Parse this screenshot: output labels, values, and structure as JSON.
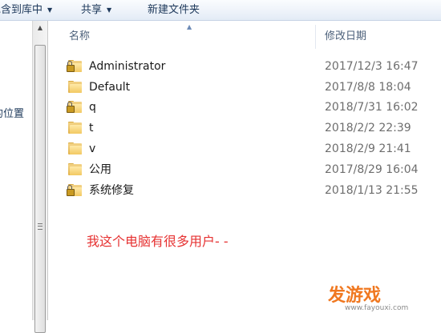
{
  "toolbar": {
    "include_in_library_label": "包含到库中",
    "share_label": "共享",
    "new_folder_label": "新建文件夹"
  },
  "nav": {
    "location_label": "的位置"
  },
  "columns": {
    "name": "名称",
    "modified": "修改日期"
  },
  "files": [
    {
      "name": "Administrator",
      "date": "2017/12/3 16:47",
      "locked": true
    },
    {
      "name": "Default",
      "date": "2017/8/8 18:04",
      "locked": false
    },
    {
      "name": "q",
      "date": "2018/7/31 16:02",
      "locked": true
    },
    {
      "name": "t",
      "date": "2018/2/2 22:39",
      "locked": false
    },
    {
      "name": "v",
      "date": "2018/2/9 21:41",
      "locked": false
    },
    {
      "name": "公用",
      "date": "2017/8/29 16:04",
      "locked": false
    },
    {
      "name": "系统修复",
      "date": "2018/1/13 21:55",
      "locked": true
    }
  ],
  "annotation": "我这个电脑有很多用户- -",
  "watermark": {
    "logo": "发游戏",
    "url": "www.fayouxi.com"
  },
  "colors": {
    "annotation": "#e63232",
    "folder": "#f2c862",
    "header_text": "#4c607a"
  }
}
